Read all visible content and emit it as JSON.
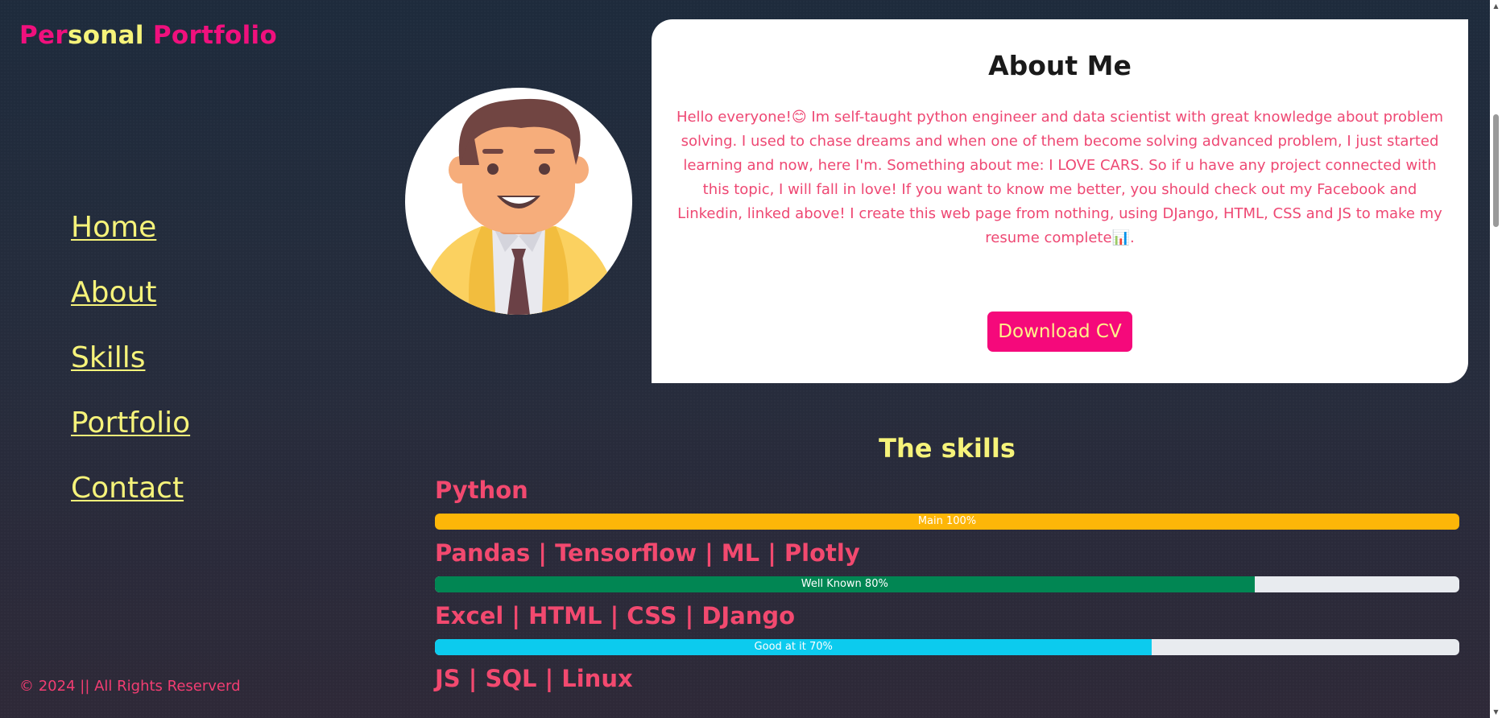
{
  "brand": {
    "part1": "Per",
    "part2": "sonal",
    "part3": " Portfolio"
  },
  "nav": [
    {
      "label": "Home"
    },
    {
      "label": "About"
    },
    {
      "label": "Skills"
    },
    {
      "label": "Portfolio"
    },
    {
      "label": "Contact"
    }
  ],
  "footer": {
    "text": "© 2024 || All Rights Reserverd"
  },
  "avatar": {
    "icon": "businessman-avatar-icon"
  },
  "about": {
    "title": "About Me",
    "text": "Hello everyone!😊 Im self-taught python engineer and data scientist with great knowledge about problem solving. I used to chase dreams and when one of them become solving advanced problem, I just started learning and now, here I'm. Something about me: I LOVE CARS. So if u have any project connected with this topic, I will fall in love! If you want to know me better, you should check out my Facebook and Linkedin, linked above! I create this web page from nothing, using DJango, HTML, CSS and JS to make my resume complete📊.",
    "download_label": "Download CV"
  },
  "skills": {
    "title": "The skills",
    "items": [
      {
        "name": "Python",
        "bar_label": "Main 100%",
        "percent": 100,
        "color": "#fdb608"
      },
      {
        "name": "Pandas | Tensorflow | ML | Plotly",
        "bar_label": "Well Known 80%",
        "percent": 80,
        "color": "#018653"
      },
      {
        "name": "Excel | HTML | CSS | DJango",
        "bar_label": "Good at it 70%",
        "percent": 70,
        "color": "#0ccbee"
      },
      {
        "name": "JS | SQL | Linux"
      }
    ]
  },
  "colors": {
    "brand_pink": "#f0107d",
    "brand_yellow": "#f6f37a",
    "accent_pink": "#ee4873",
    "button": "#f5097b"
  }
}
